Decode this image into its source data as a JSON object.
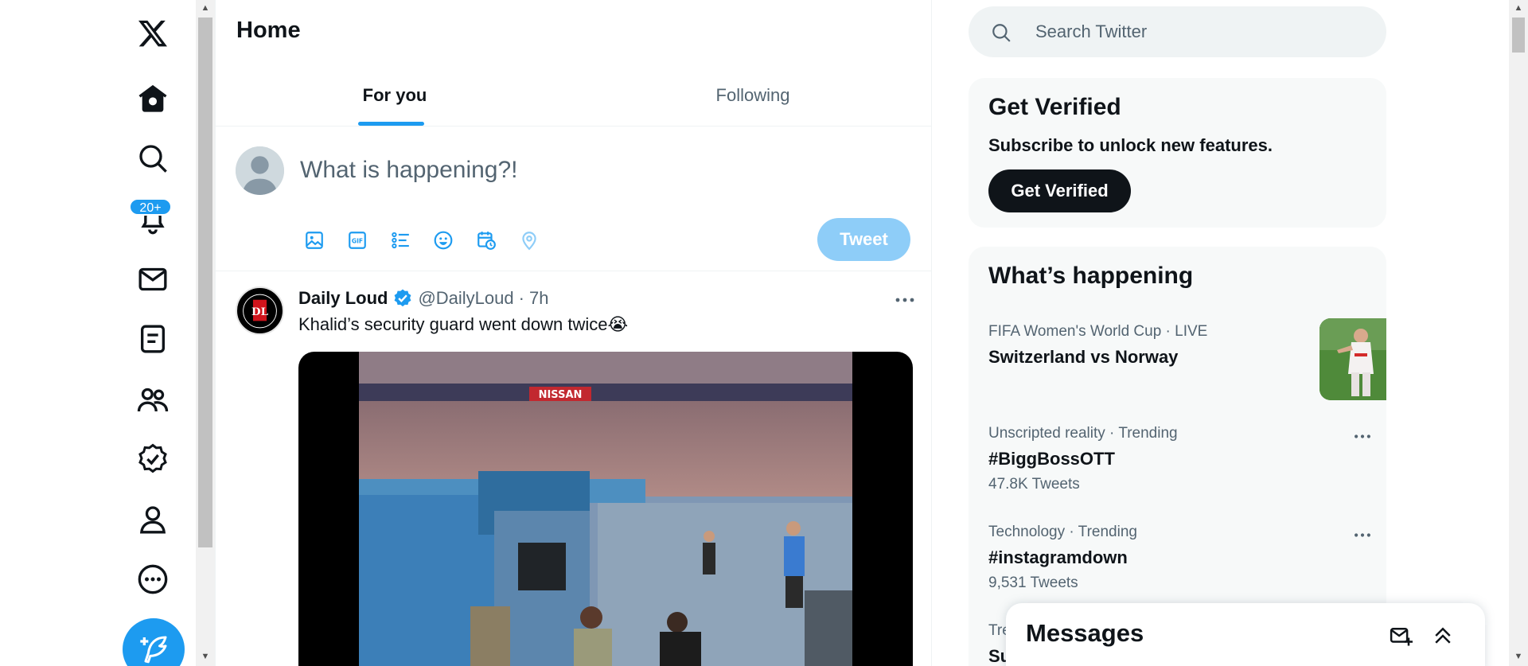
{
  "nav": {
    "notifications_badge": "20+",
    "items": [
      "x-logo",
      "home",
      "explore",
      "notifications",
      "messages",
      "lists",
      "communities",
      "verified",
      "profile",
      "more"
    ]
  },
  "main": {
    "title": "Home",
    "tabs": [
      {
        "label": "For you",
        "active": true
      },
      {
        "label": "Following",
        "active": false
      }
    ],
    "composer": {
      "placeholder": "What is happening?!",
      "tools": [
        "image-icon",
        "gif-icon",
        "poll-icon",
        "emoji-icon",
        "schedule-icon",
        "location-icon"
      ],
      "tweet_label": "Tweet"
    },
    "tweet": {
      "name": "Daily Loud",
      "handle": "@DailyLoud",
      "dot": "·",
      "time": "7h",
      "text": "Khalid’s security guard went down twice😭",
      "avatar_text": "DL",
      "media_banner": "NISSAN"
    }
  },
  "sidebar": {
    "search_placeholder": "Search Twitter",
    "verify": {
      "title": "Get Verified",
      "subtitle": "Subscribe to unlock new features.",
      "button": "Get Verified"
    },
    "trends": {
      "title": "What’s happening",
      "items": [
        {
          "meta": "FIFA Women's World Cup · LIVE",
          "name": "Switzerland vs Norway",
          "count": ""
        },
        {
          "meta": "Unscripted reality · Trending",
          "name": "#BiggBossOTT",
          "count": "47.8K Tweets"
        },
        {
          "meta": "Technology · Trending",
          "name": "#instagramdown",
          "count": "9,531 Tweets"
        },
        {
          "meta": "Tre",
          "name": "Su",
          "count": ""
        }
      ]
    }
  },
  "messages": {
    "title": "Messages"
  },
  "colors": {
    "accent": "#1d9bf0",
    "tweet_button_disabled": "#8ecdf8",
    "text_primary": "#0f1419",
    "text_secondary": "#536471",
    "card_bg": "#f7f9f9"
  }
}
